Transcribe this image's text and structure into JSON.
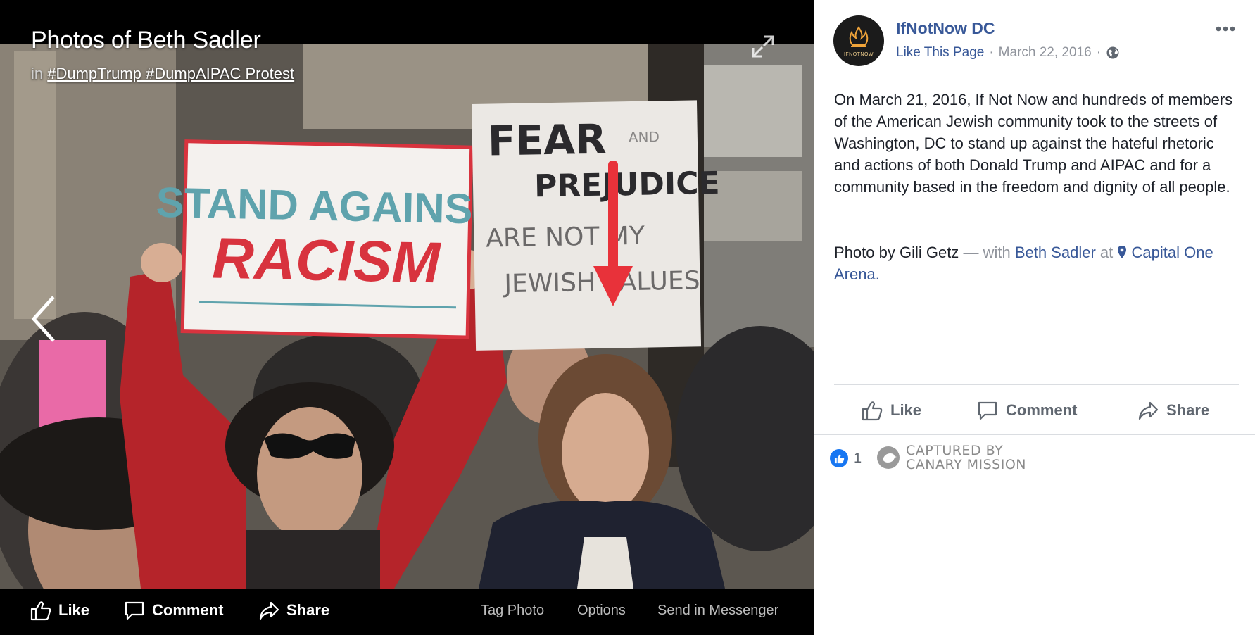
{
  "viewer": {
    "title": "Photos of Beth Sadler",
    "album_prefix": "in",
    "album": "#DumpTrump #DumpAIPAC Protest",
    "photo_alt": "Protesters holding signs reading STAND AGAINST RACISM and FEAR AND PREJUDICE ARE NOT MY JEWISH VALUES, with a red arrow pointing at a woman",
    "signs": {
      "sign1_line1": "STAND AGAINST",
      "sign1_line2": "RACISM",
      "sign2_line1": "FEAR",
      "sign2_line1_small": "AND",
      "sign2_line2": "PREJUDICE",
      "sign2_line3": "ARE NOT MY",
      "sign2_line4": "JEWISH VALUES"
    },
    "bar": {
      "like": "Like",
      "comment": "Comment",
      "share": "Share",
      "tag_photo": "Tag Photo",
      "options": "Options",
      "send": "Send in Messenger"
    }
  },
  "post": {
    "page_name": "IfNotNow DC",
    "avatar_text": "IFNOTNOW",
    "like_page": "Like This Page",
    "separator": "·",
    "date": "March 22, 2016",
    "text": "On March 21, 2016, If Not Now and hundreds of members of the American Jewish community took to the streets of Washington, DC to stand up against the hateful rhetoric and actions of both Donald Trump and AIPAC and for a community based in the freedom and dignity of all people.",
    "credit_prefix": "Photo by Gili Getz",
    "with_text": "— with",
    "tagged_person": "Beth Sadler",
    "at_text": "at",
    "location": "Capital One Arena.",
    "actions": {
      "like": "Like",
      "comment": "Comment",
      "share": "Share"
    },
    "reaction_count": "1",
    "watermark_line1": "CAPTURED BY",
    "watermark_line2": "CANARY MISSION"
  },
  "colors": {
    "link": "#385898",
    "muted": "#90949c",
    "like_blue": "#1877f2",
    "arrow_red": "#e8323a",
    "sign_red": "#d8333e",
    "sign_teal": "#5fa3ad"
  }
}
